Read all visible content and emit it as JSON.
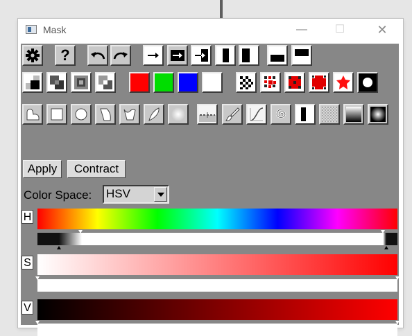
{
  "window": {
    "title": "Mask"
  },
  "titlebar": {
    "minimize": "—",
    "maximize": "☐",
    "close": "✕"
  },
  "toolbar": {
    "row1": [
      "settings-icon",
      "help-icon",
      "undo-icon",
      "redo-icon",
      "arrow-right-icon",
      "arrow-right-box-icon",
      "arrow-into-box-icon",
      "invert-left-icon",
      "invert-right-icon",
      "half-bottom-icon",
      "half-top-icon"
    ],
    "help_label": "?",
    "row2_blend_icons": [
      "blend-mode-1-icon",
      "blend-mode-2-icon",
      "blend-mode-3-icon",
      "blend-mode-4-icon"
    ],
    "row2_colors": [
      "#ff0000",
      "#00dd00",
      "#0000ff",
      "#ffffff"
    ],
    "row2_patterns": [
      "pattern-checker-icon",
      "pattern-red-dots-1-icon",
      "pattern-red-dots-2-icon",
      "pattern-red-dots-3-icon",
      "pattern-red-star-icon",
      "circle-white-icon"
    ],
    "row3": [
      "lasso-icon",
      "rectangle-icon",
      "ellipse-icon",
      "polygon-icon",
      "freeform-icon",
      "feather-icon",
      "glow-icon",
      "horizon-line-icon",
      "brush-icon",
      "curve-icon",
      "spiral-icon",
      "split-bw-icon",
      "noise-icon",
      "linear-gradient-icon",
      "radial-gradient-icon"
    ]
  },
  "actions": {
    "apply": "Apply",
    "contract": "Contract"
  },
  "color_space": {
    "label": "Color Space:",
    "value": "HSV"
  },
  "channels": [
    {
      "label": "H",
      "range_min": 0.12,
      "range_max": 0.96,
      "falloff_lo": 0.06,
      "falloff_hi": 0.97
    },
    {
      "label": "S",
      "range_min": 0.0,
      "range_max": 1.0
    },
    {
      "label": "V",
      "range_min": 0.0,
      "range_max": 1.0
    }
  ]
}
